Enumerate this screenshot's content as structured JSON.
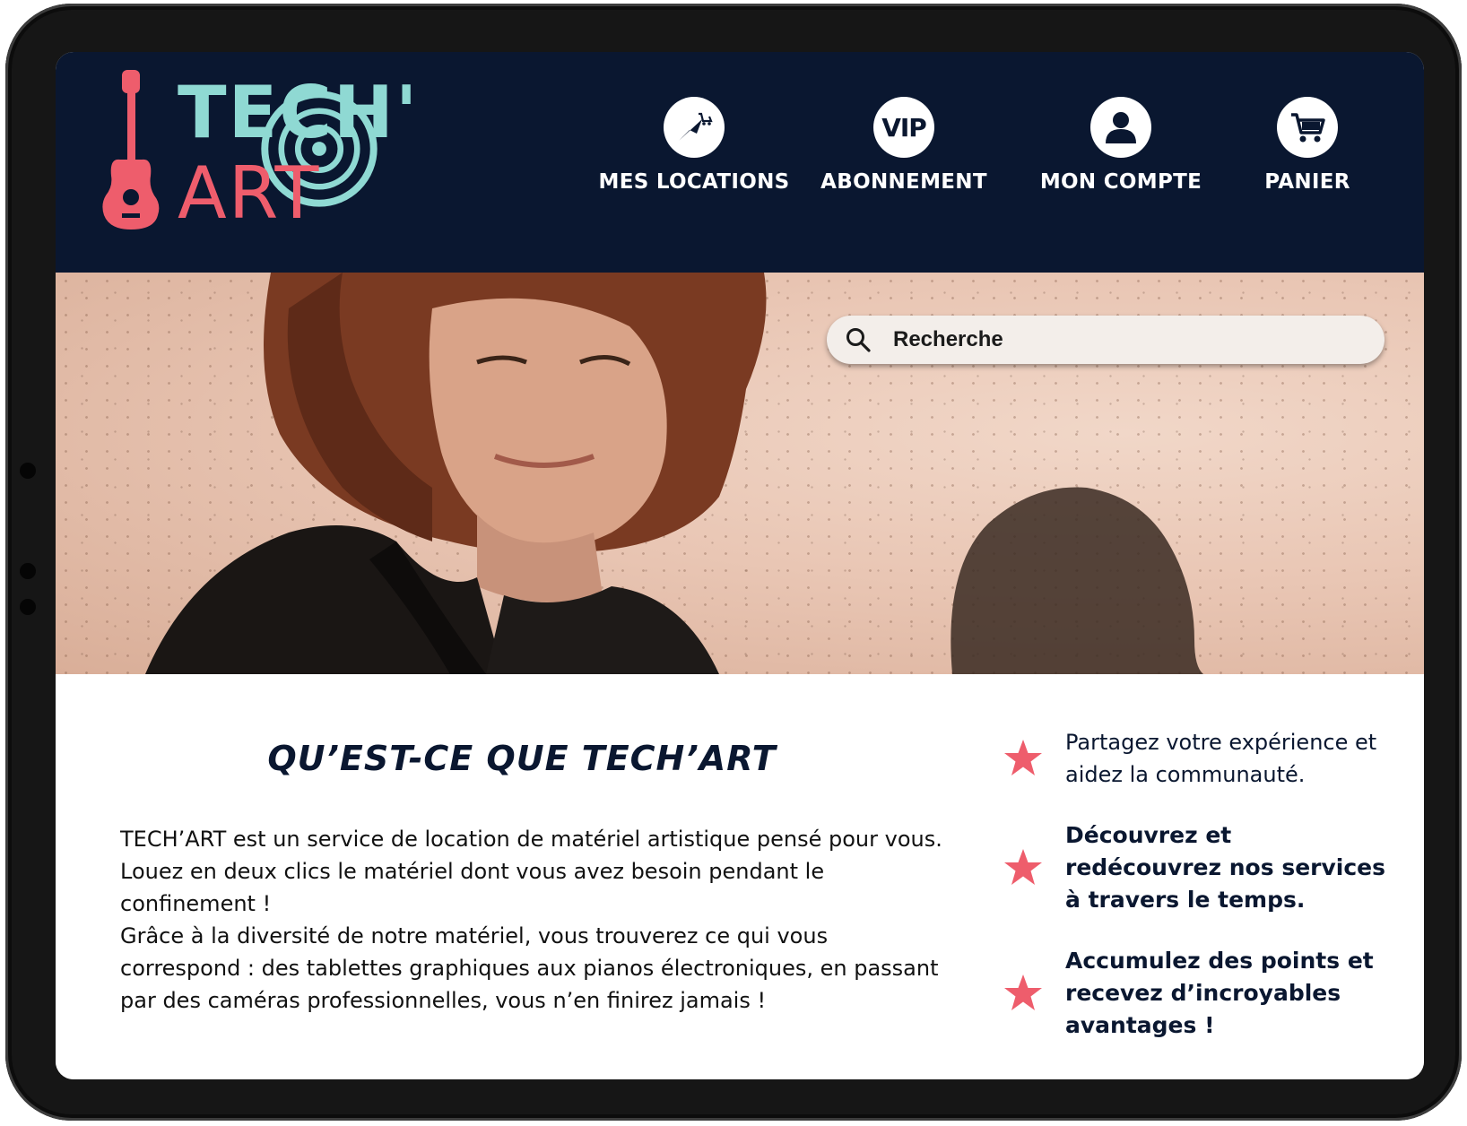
{
  "brand": {
    "line1": "TECH'",
    "line2": "ART",
    "color_teal": "#8fd9d3",
    "color_coral": "#ee5d6c"
  },
  "nav": [
    {
      "label": "MES LOCATIONS",
      "icon": "rental-cart-icon"
    },
    {
      "label": "ABONNEMENT",
      "icon": "vip-icon",
      "icon_text": "VIP"
    },
    {
      "label": "MON COMPTE",
      "icon": "user-icon"
    },
    {
      "label": "PANIER",
      "icon": "shopping-cart-icon"
    }
  ],
  "search": {
    "placeholder": "Recherche"
  },
  "carousel": {
    "slides": 3,
    "active": 2
  },
  "about": {
    "title": "QU’EST-CE QUE TECH’ART",
    "paragraph1": "TECH’ART est un service de location de matériel artistique pensé pour vous. Louez en deux clics le matériel dont vous avez besoin pendant le confinement !",
    "paragraph2": "Grâce à la diversité de notre matériel, vous trouverez ce qui vous correspond : des tablettes graphiques aux pianos électroniques, en passant par des caméras professionnelles, vous n’en finirez jamais !"
  },
  "features": [
    {
      "text": "Partagez votre expérience et aidez la communauté.",
      "icon": "star-icon"
    },
    {
      "text": "Découvrez et redécouvrez nos services à travers le temps.",
      "icon": "star-icon"
    },
    {
      "text": "Accumulez des points et recevez d’incroyables avantages !",
      "icon": "star-icon"
    }
  ],
  "colors": {
    "header_bg": "#0a1730",
    "accent": "#ee5d6c",
    "text_dark": "#0a1730"
  }
}
